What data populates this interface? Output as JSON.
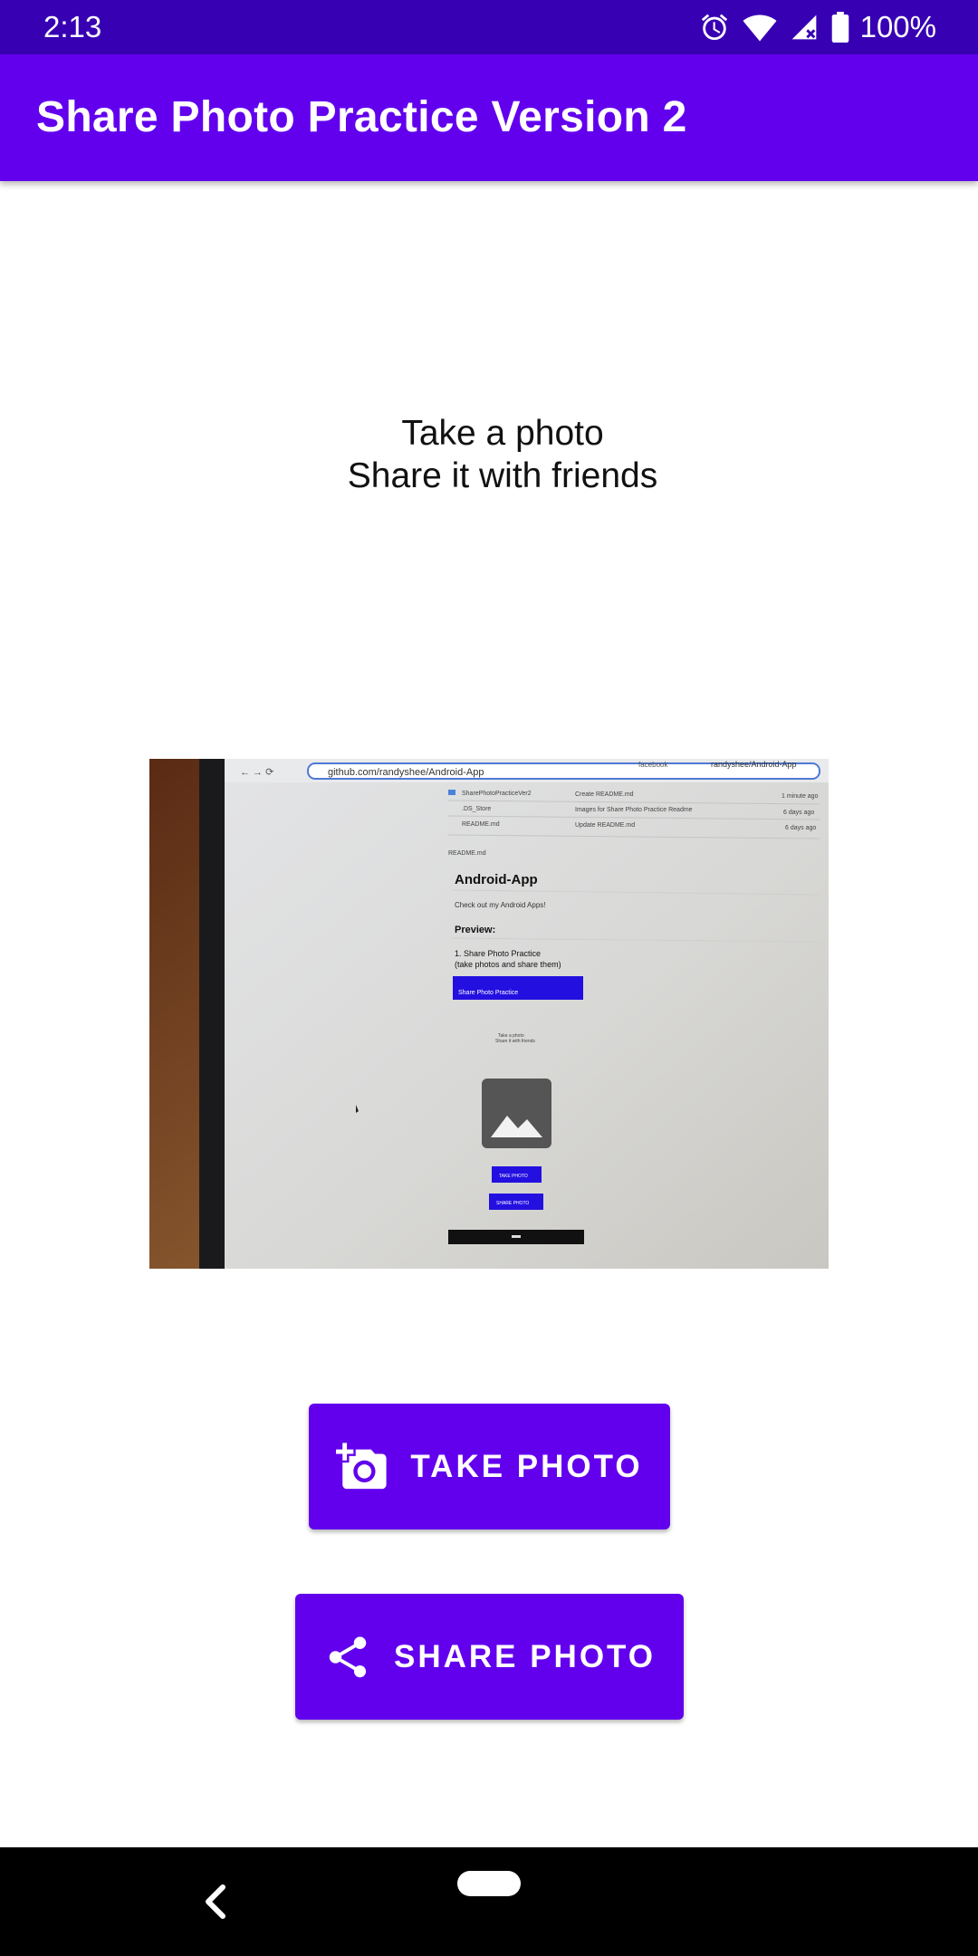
{
  "status_bar": {
    "time": "2:13",
    "battery": "100%",
    "icons": [
      "alarm-icon",
      "wifi-icon",
      "cell-signal-icon",
      "battery-icon"
    ]
  },
  "app_bar": {
    "title": "Share Photo Practice Version 2"
  },
  "intro": {
    "line1": "Take a photo",
    "line2": "Share it with friends"
  },
  "photo": {
    "browser": {
      "tab1": "facebook",
      "tab2": "randyshee/Android-App",
      "url": "github.com/randyshee/Android-App"
    },
    "files": [
      {
        "name": "SharePhotoPracticeVer2",
        "message": "Create README.md",
        "time": "1 minute ago"
      },
      {
        "name": ".DS_Store",
        "message": "Images for Share Photo Practice Readme",
        "time": "6 days ago"
      },
      {
        "name": "README.md",
        "message": "Update README.md",
        "time": "6 days ago"
      }
    ],
    "readme_label": "README.md",
    "heading": "Android-App",
    "subtitle": "Check out my Android Apps!",
    "preview_label": "Preview:",
    "item_line1": "1. Share Photo Practice",
    "item_line2": "(take photos and share them)",
    "mini_app_title": "Share Photo Practice",
    "mini_line1": "Take a photo",
    "mini_line2": "Share it with friends",
    "mini_take": "TAKE PHOTO",
    "mini_share": "SHARE PHOTO"
  },
  "buttons": {
    "take_label": "TAKE PHOTO",
    "share_label": "SHARE PHOTO"
  },
  "nav_bar": {
    "icons": [
      "back-icon",
      "home-pill"
    ]
  },
  "colors": {
    "status_bar": "#3700b3",
    "primary": "#6200ee",
    "on_primary": "#ffffff",
    "nav_bar": "#000000"
  }
}
